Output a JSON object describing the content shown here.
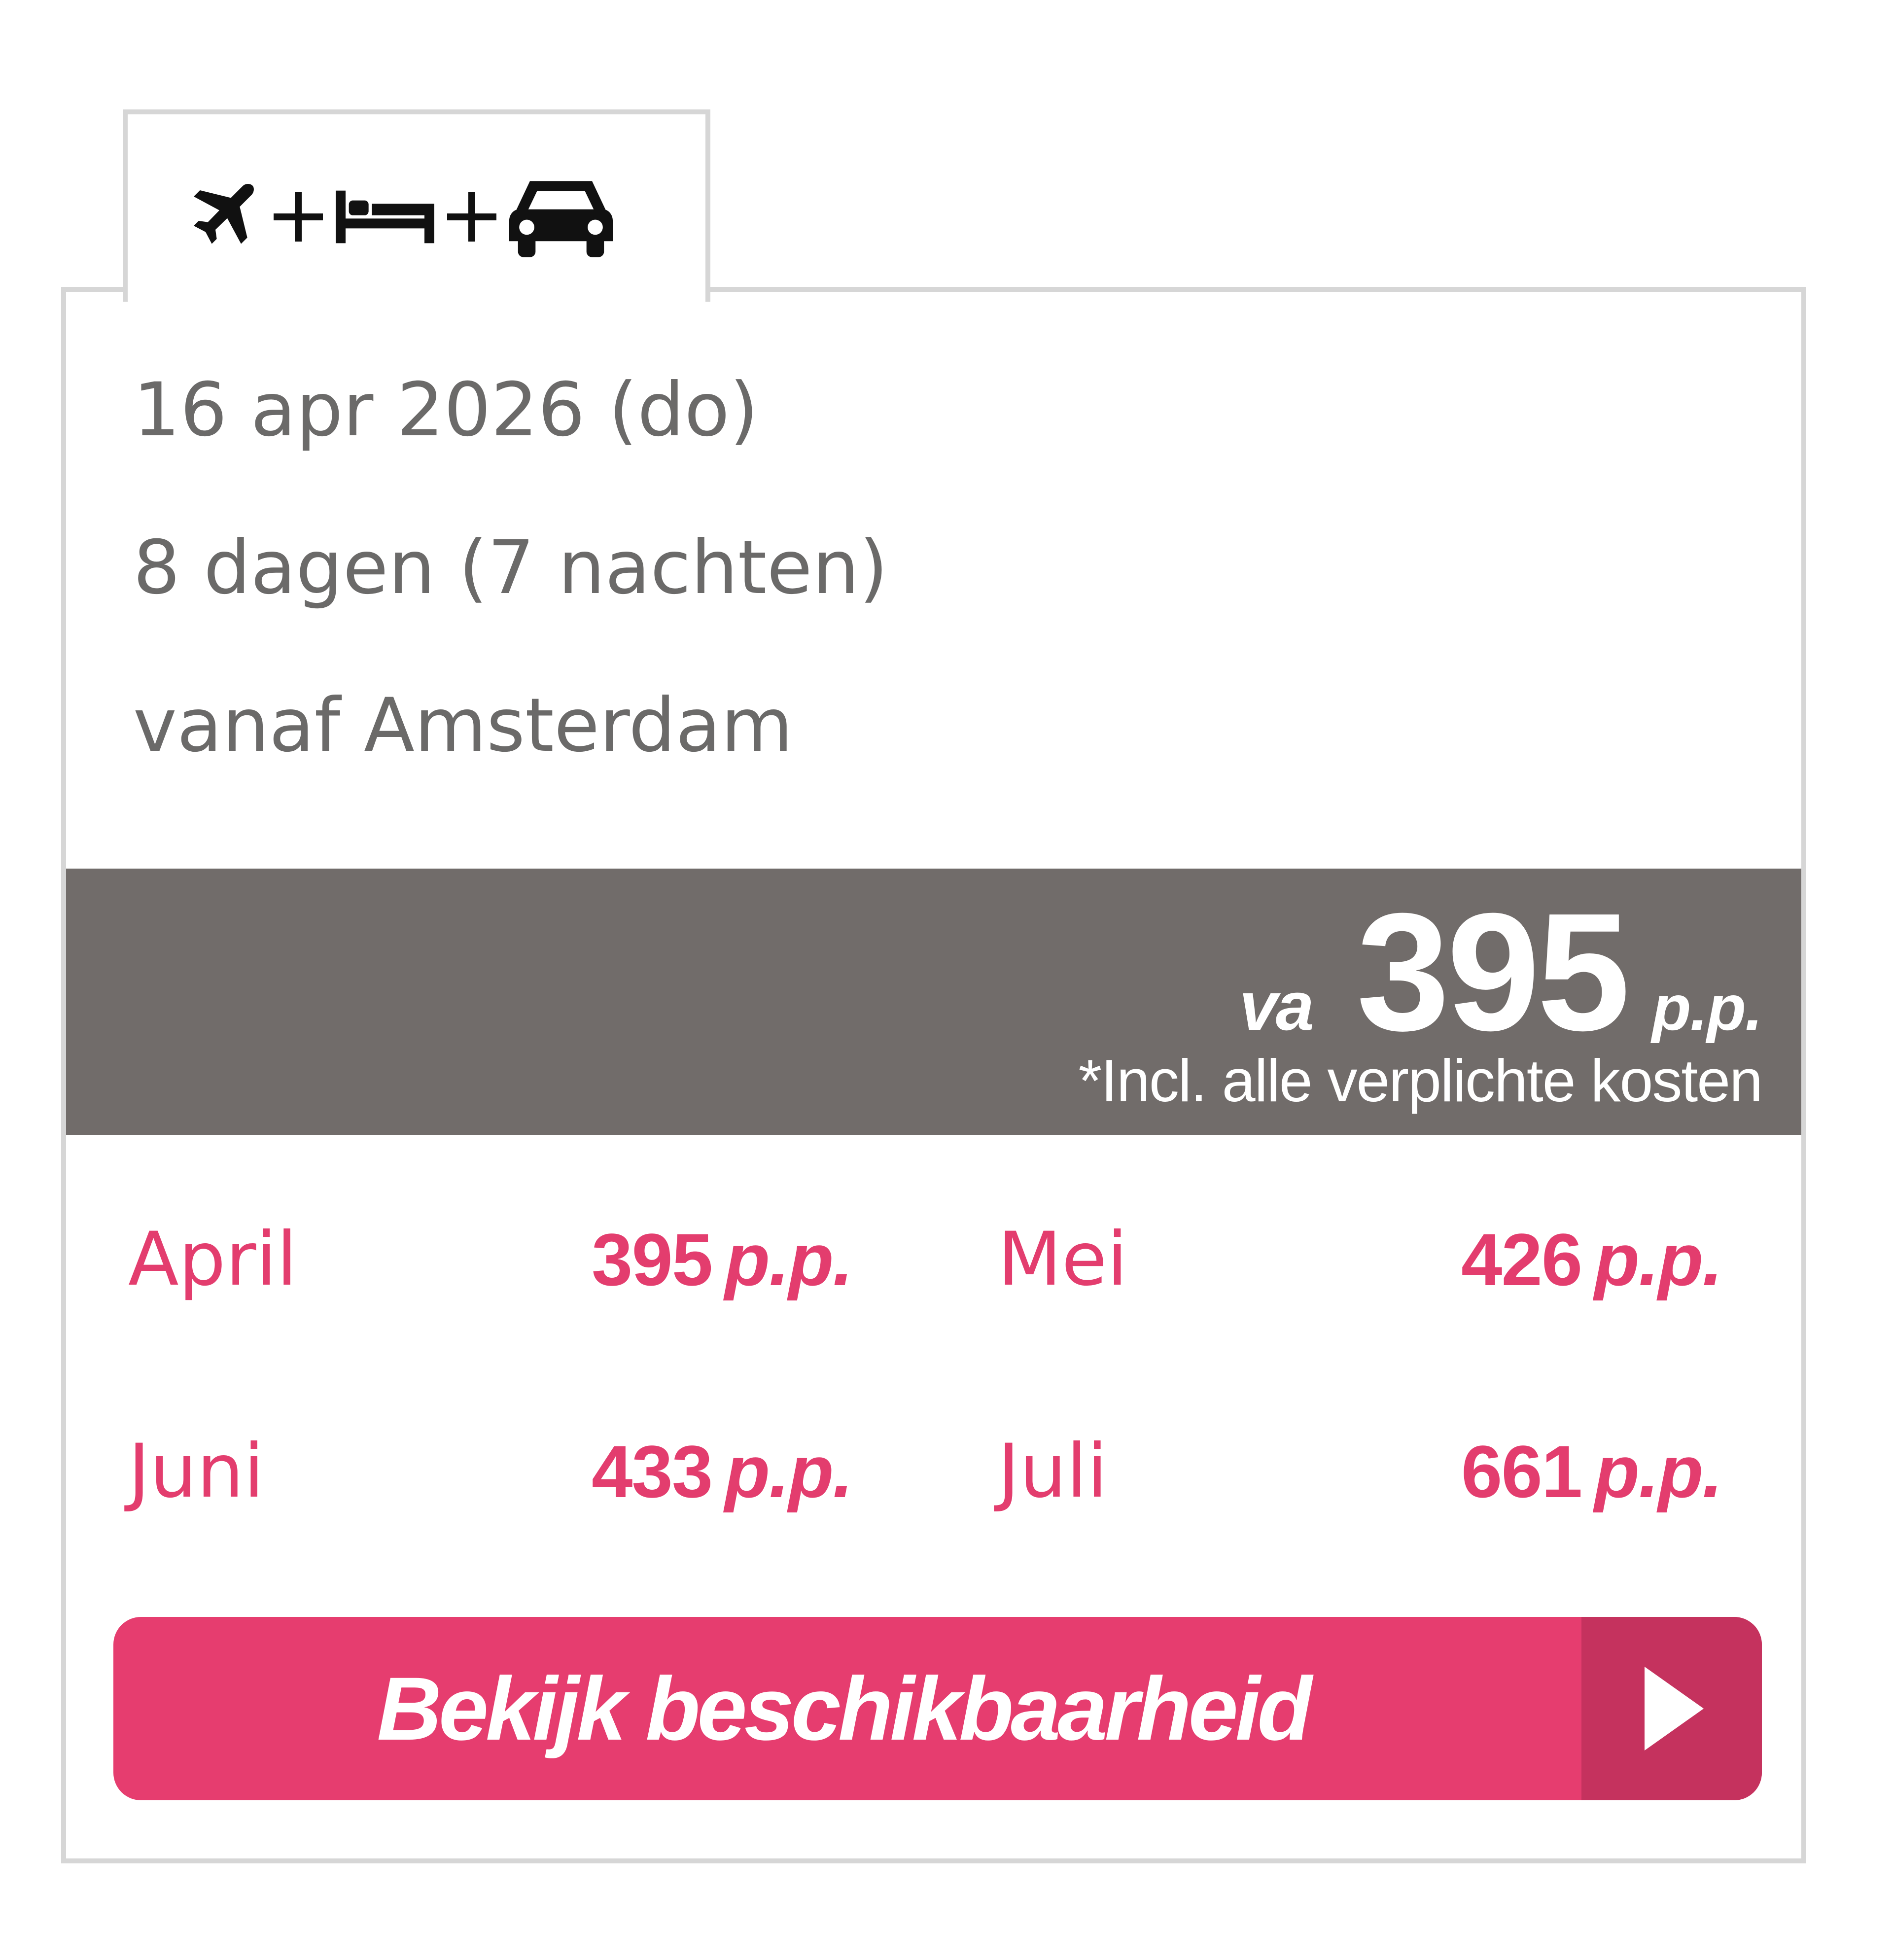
{
  "tab": {
    "icons": [
      "airplane-icon",
      "plus-icon",
      "bed-icon",
      "plus-icon",
      "car-icon"
    ]
  },
  "trip": {
    "date": "16 apr 2026 (do)",
    "duration": "8 dagen (7 nachten)",
    "departure": "vanaf Amsterdam"
  },
  "price": {
    "prefix": "va",
    "amount": "395",
    "suffix": "p.p.",
    "note": "*Incl. alle verplichte kosten"
  },
  "months": [
    {
      "name": "April",
      "price": "395",
      "unit": "p.p."
    },
    {
      "name": "Mei",
      "price": "426",
      "unit": "p.p."
    },
    {
      "name": "Juni",
      "price": "433",
      "unit": "p.p."
    },
    {
      "name": "Juli",
      "price": "661",
      "unit": "p.p."
    }
  ],
  "cta": {
    "label": "Bekijk beschikbaarheid",
    "icon": "arrow-right-icon"
  },
  "colors": {
    "accent": "#e63d6f",
    "accent_dark": "#c5325e",
    "price_band": "#716c6a",
    "text_gray": "#6b6a69",
    "border": "#d6d6d6"
  }
}
